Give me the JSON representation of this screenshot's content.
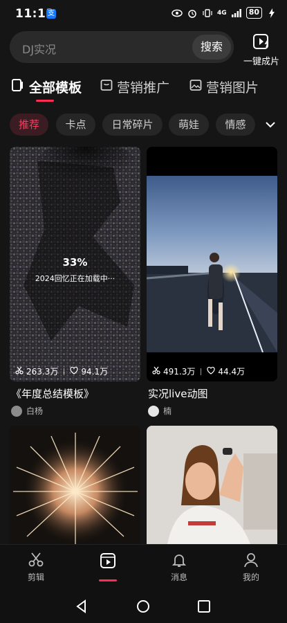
{
  "status": {
    "time": "11:13",
    "network": "4G",
    "signal": "ıll",
    "battery": "80"
  },
  "search": {
    "placeholder": "DJ实况",
    "button": "搜索"
  },
  "one_click": {
    "label": "一键成片"
  },
  "category_tabs": [
    {
      "label": "全部模板",
      "active": true
    },
    {
      "label": "营销推广",
      "active": false
    },
    {
      "label": "营销图片",
      "active": false
    }
  ],
  "chips": [
    {
      "label": "推荐",
      "active": true
    },
    {
      "label": "卡点",
      "active": false
    },
    {
      "label": "日常碎片",
      "active": false
    },
    {
      "label": "萌娃",
      "active": false
    },
    {
      "label": "情感",
      "active": false
    }
  ],
  "cards": [
    {
      "title": "《年度总结模板》",
      "author": "白杨",
      "uses": "263.3万",
      "likes": "94.1万",
      "progress_text": "33%",
      "progress_value": 0.33,
      "loading_text": "2024回忆正在加载中···"
    },
    {
      "title": "实况live动图",
      "author": "楠",
      "uses": "491.3万",
      "likes": "44.4万"
    }
  ],
  "bottom_nav": [
    {
      "label": "剪辑",
      "active": false
    },
    {
      "label": "",
      "active": true
    },
    {
      "label": "消息",
      "active": false
    },
    {
      "label": "我的",
      "active": false
    }
  ],
  "colors": {
    "accent": "#ff2d55",
    "background": "#151515",
    "chip_bg": "#262626"
  }
}
